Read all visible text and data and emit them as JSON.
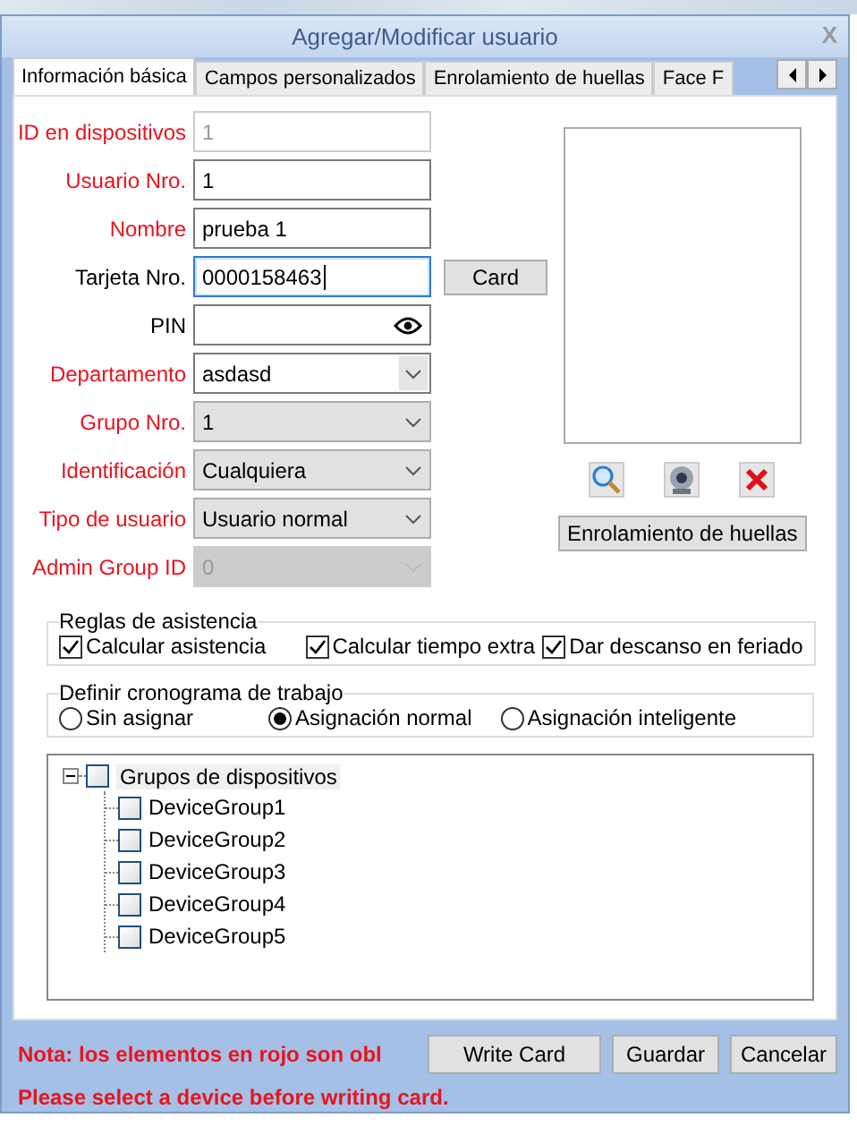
{
  "window": {
    "title": "Agregar/Modificar usuario",
    "close": "X"
  },
  "tabs": [
    {
      "label": "Información básica",
      "selected": true
    },
    {
      "label": "Campos personalizados",
      "selected": false
    },
    {
      "label": "Enrolamiento de huellas",
      "selected": false
    },
    {
      "label": "Face F",
      "selected": false
    }
  ],
  "fields": [
    {
      "label": "ID en dispositivos",
      "required": true,
      "kind": "text",
      "value": "1",
      "disabled": true,
      "focused": false
    },
    {
      "label": "Usuario Nro.",
      "required": true,
      "kind": "text",
      "value": "1",
      "disabled": false,
      "focused": false
    },
    {
      "label": "Nombre",
      "required": true,
      "kind": "text",
      "value": "prueba 1",
      "disabled": false,
      "focused": false
    },
    {
      "label": "Tarjeta Nro.",
      "required": false,
      "kind": "text",
      "value": "0000158463",
      "disabled": false,
      "focused": true
    },
    {
      "label": "PIN",
      "required": false,
      "kind": "password",
      "disabled": false,
      "focused": false
    },
    {
      "label": "Departamento",
      "required": true,
      "kind": "combo",
      "value": "asdasd",
      "disabled": false,
      "focused": false
    },
    {
      "label": "Grupo Nro.",
      "required": true,
      "kind": "select",
      "value": "1",
      "disabled": false,
      "focused": false
    },
    {
      "label": "Identificación",
      "required": true,
      "kind": "select",
      "value": "Cualquiera",
      "disabled": false,
      "focused": false
    },
    {
      "label": "Tipo de usuario",
      "required": true,
      "kind": "select",
      "value": "Usuario normal",
      "disabled": false,
      "focused": false
    },
    {
      "label": "Admin Group ID",
      "required": true,
      "kind": "select",
      "value": "0",
      "disabled": true,
      "focused": false
    }
  ],
  "card_button": "Card",
  "enroll_button": "Enrolamiento de huellas",
  "attendance_rules": {
    "title": "Reglas de asistencia",
    "options": [
      {
        "label": "Calcular asistencia",
        "checked": true
      },
      {
        "label": "Calcular tiempo extra",
        "checked": true
      },
      {
        "label": "Dar descanso en feriado",
        "checked": true
      }
    ]
  },
  "schedule": {
    "title": "Definir cronograma de trabajo",
    "options": [
      {
        "label": "Sin asignar",
        "selected": false
      },
      {
        "label": "Asignación normal",
        "selected": true
      },
      {
        "label": "Asignación inteligente",
        "selected": false
      }
    ]
  },
  "tree": {
    "label": "Grupos de dispositivos",
    "checked": false,
    "expanded": true,
    "children": [
      {
        "label": "DeviceGroup1",
        "checked": false
      },
      {
        "label": "DeviceGroup2",
        "checked": false
      },
      {
        "label": "DeviceGroup3",
        "checked": false
      },
      {
        "label": "DeviceGroup4",
        "checked": false
      },
      {
        "label": "DeviceGroup5",
        "checked": false
      }
    ]
  },
  "note": "Nota: los elementos en rojo son obl",
  "warning": "Please select a device before writing card.",
  "buttons": [
    "Write Card",
    "Guardar",
    "Cancelar"
  ]
}
